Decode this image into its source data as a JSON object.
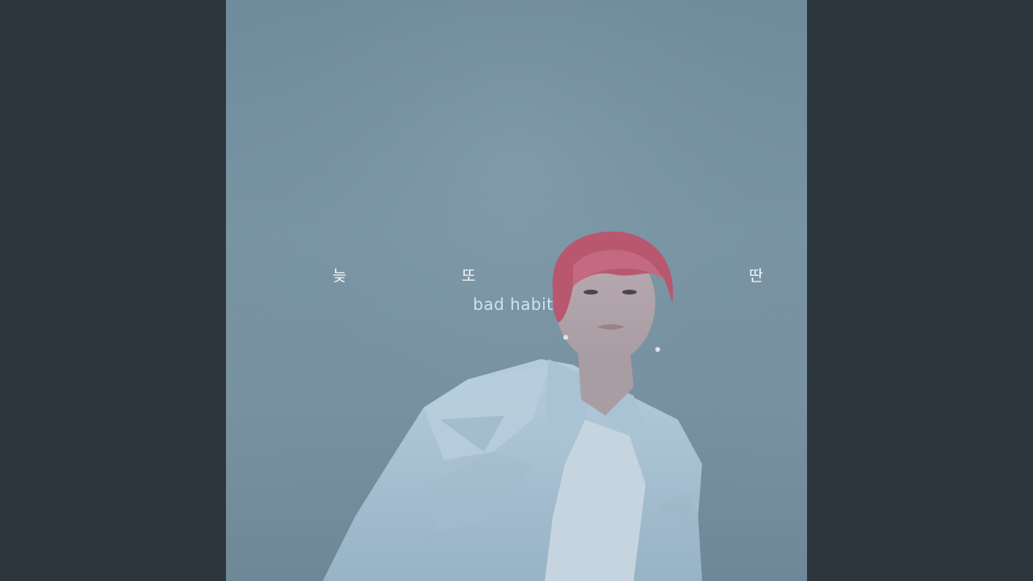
{
  "cover": {
    "korean_words": [
      "늦",
      "또",
      "딴"
    ],
    "title": "bad habit"
  },
  "colors": {
    "letterbox": "#2d363d",
    "sky": "#7592a2",
    "hair": "#b8576e",
    "denim": "#a4bfd2",
    "title_text": "#cfe3f5"
  }
}
